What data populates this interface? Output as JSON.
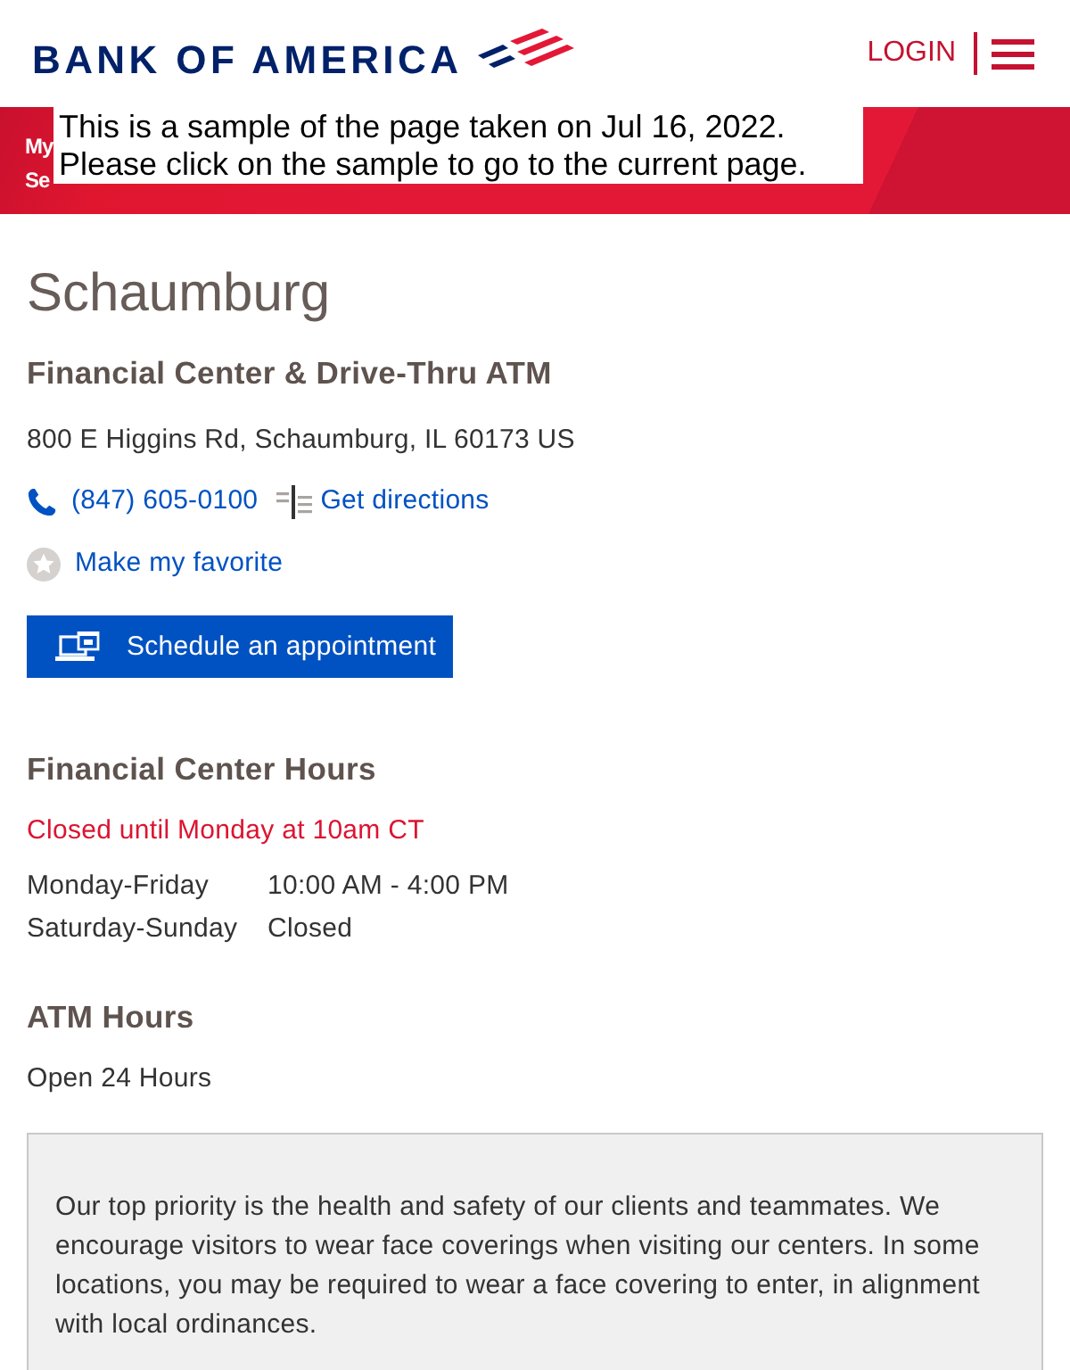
{
  "header": {
    "logo": "BANK OF AMERICA",
    "login": "LOGIN"
  },
  "banner": {
    "lines": [
      "My",
      "Se"
    ]
  },
  "archive_notice": {
    "lines": [
      "This is a sample of the page taken on Jul 16, 2022.",
      "Please click on the sample to go to the current page."
    ]
  },
  "location": {
    "name": "Schaumburg",
    "type": "Financial Center & Drive-Thru ATM",
    "address": "800 E Higgins Rd, Schaumburg, IL 60173 US",
    "phone": "(847) 605-0100",
    "directions": "Get directions",
    "favorite": {
      "label": "Make my favorite",
      "on": false
    },
    "appointment_button": "Schedule an appointment"
  },
  "financial_center_hours": {
    "title": "Financial Center Hours",
    "status": "Closed until Monday at 10am CT",
    "rows": [
      {
        "days": "Monday-Friday",
        "hours": "10:00 AM - 4:00 PM"
      },
      {
        "days": "Saturday-Sunday",
        "hours": "Closed"
      }
    ]
  },
  "atm_hours": {
    "title": "ATM Hours",
    "text": "Open 24 Hours"
  },
  "notice": {
    "text": "Our top priority is the health and safety of our clients and teammates. We encourage visitors to wear face coverings when visiting our centers. In some locations, you may be required to wear a face covering to enter, in alignment with local ordinances."
  }
}
